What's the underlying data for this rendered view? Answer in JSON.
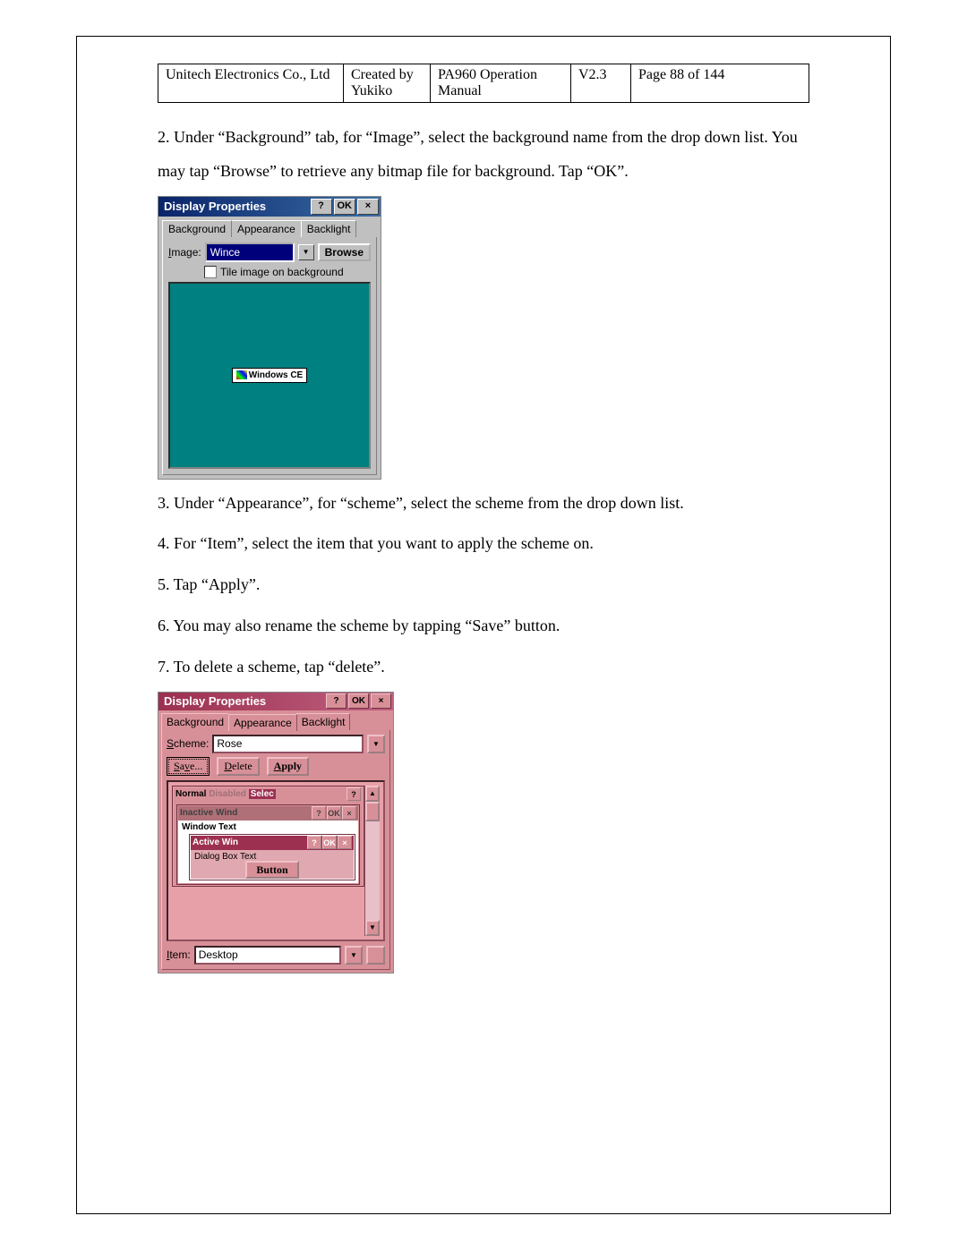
{
  "header": {
    "company": "Unitech Electronics Co., Ltd",
    "created": "Created by Yukiko",
    "manual": "PA960 Operation Manual",
    "version": "V2.3",
    "page": "Page 88 of 144"
  },
  "para": {
    "p2": "2. Under “Background” tab, for “Image”, select the background name from the drop down list. You may tap “Browse” to retrieve any bitmap file for background. Tap “OK”.",
    "p3": "3. Under “Appearance”, for “scheme”, select the scheme from the drop down list.",
    "p4": "4. For “Item”, select the item that you want to apply the scheme on.",
    "p5": "5. Tap “Apply”.",
    "p6": "6. You may also rename the scheme by tapping “Save” button.",
    "p7": "7. To delete a scheme, tap “delete”."
  },
  "s1": {
    "title": "Display Properties",
    "help": "?",
    "ok": "OK",
    "close": "×",
    "tabs": [
      "Background",
      "Appearance",
      "Backlight"
    ],
    "imgLabel": "Image:",
    "imgVal": "Wince",
    "browse": "Browse",
    "tile": "Tile image on background",
    "wince": "Windows CE"
  },
  "s2": {
    "title": "Display Properties",
    "help": "?",
    "ok": "OK",
    "close": "×",
    "tabs": [
      "Background",
      "Appearance",
      "Backlight"
    ],
    "schemeLabel": "Scheme:",
    "schemeVal": "Rose",
    "save": "Save...",
    "delete": "Delete",
    "apply": "Apply",
    "normal": "Normal",
    "disabled": "Disabled",
    "selected": "Selec",
    "inactive": "Inactive Wind",
    "winText": "Window Text",
    "active": "Active Win",
    "dlgText": "Dialog Box Text",
    "button": "Button",
    "itemLabel": "Item:",
    "itemVal": "Desktop",
    "up": "▲",
    "down": "▼"
  }
}
